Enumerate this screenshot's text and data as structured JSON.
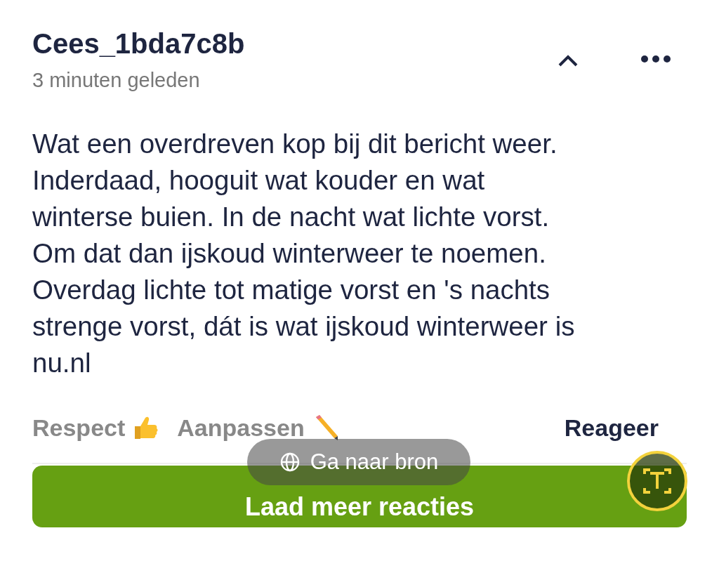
{
  "comment": {
    "author": "Cees_1bda7c8b",
    "time": "3 minuten geleden",
    "expanded": true,
    "body": "Wat een overdreven kop bij dit bericht weer.\nInderdaad, hooguit wat kouder en wat\nwinterse buien. In de nacht wat lichte vorst.\nOm dat dan ijskoud winterweer te noemen.\nOverdag lichte tot matige vorst en 's nachts\nstrenge vorst, dát is wat ijskoud winterweer is\nnu.nl"
  },
  "actions": [
    {
      "label": "Respect",
      "kind": "respect"
    },
    {
      "label": "Aanpassen",
      "kind": "edit"
    }
  ],
  "reply": {
    "label": "Reageer"
  },
  "load_more": {
    "label": "Laad meer reacties"
  },
  "overlay": {
    "label": "Ga naar bron"
  }
}
